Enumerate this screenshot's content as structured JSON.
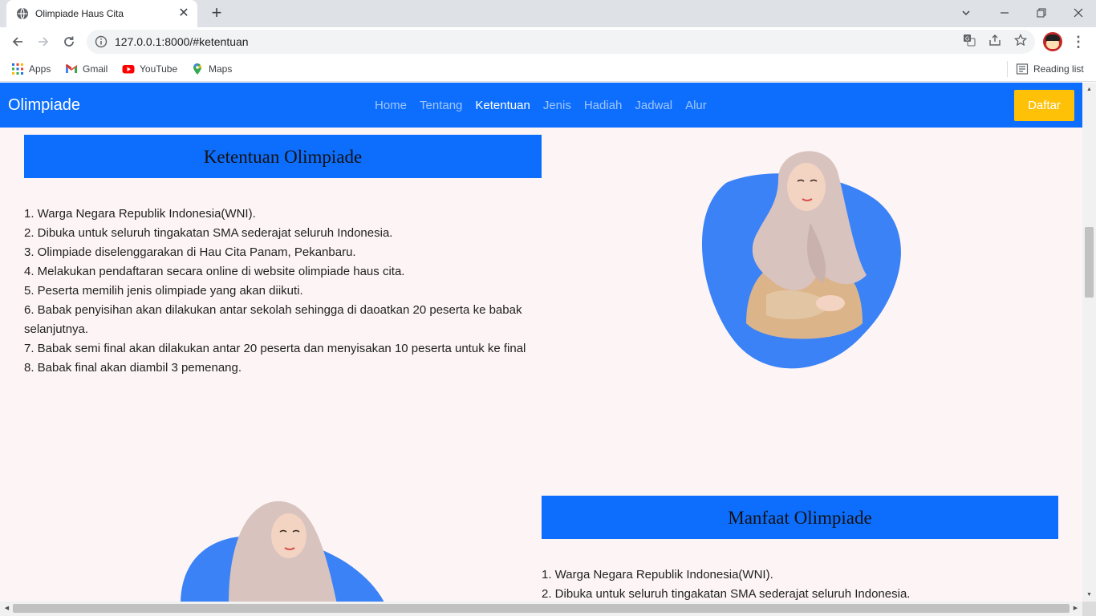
{
  "browser": {
    "tab_title": "Olimpiade Haus Cita",
    "tab_close": "✕",
    "new_tab": "+",
    "url": "127.0.0.1:8000/#ketentuan",
    "bookmarks": [
      {
        "label": "Apps",
        "icon": "apps-grid-icon"
      },
      {
        "label": "Gmail",
        "icon": "gmail-icon"
      },
      {
        "label": "YouTube",
        "icon": "youtube-icon"
      },
      {
        "label": "Maps",
        "icon": "maps-icon"
      }
    ],
    "reading_list": "Reading list"
  },
  "navbar": {
    "brand": "Olimpiade",
    "links": [
      "Home",
      "Tentang",
      "Ketentuan",
      "Jenis",
      "Hadiah",
      "Jadwal",
      "Alur"
    ],
    "active_link": "Ketentuan",
    "cta": "Daftar",
    "colors": {
      "bar": "#0d6efd",
      "cta": "#ffc107"
    }
  },
  "ketentuan": {
    "title": "Ketentuan Olimpiade",
    "items": [
      "1. Warga Negara Republik Indonesia(WNI).",
      "2. Dibuka untuk seluruh tingakatan SMA sederajat seluruh Indonesia.",
      "3. Olimpiade diselenggarakan di Hau Cita Panam, Pekanbaru.",
      "4. Melakukan pendaftaran secara online di website olimpiade haus cita.",
      "5. Peserta memilih jenis olimpiade yang akan diikuti.",
      "6. Babak penyisihan akan dilakukan antar sekolah sehingga di daoatkan 20 peserta ke babak selanjutnya.",
      "7. Babak semi final akan dilakukan antar 20 peserta dan menyisakan 10 peserta untuk ke final",
      "8. Babak final akan diambil 3 pemenang."
    ]
  },
  "manfaat": {
    "title": "Manfaat Olimpiade",
    "items": [
      "1. Warga Negara Republik Indonesia(WNI).",
      "2. Dibuka untuk seluruh tingakatan SMA sederajat seluruh Indonesia."
    ]
  }
}
